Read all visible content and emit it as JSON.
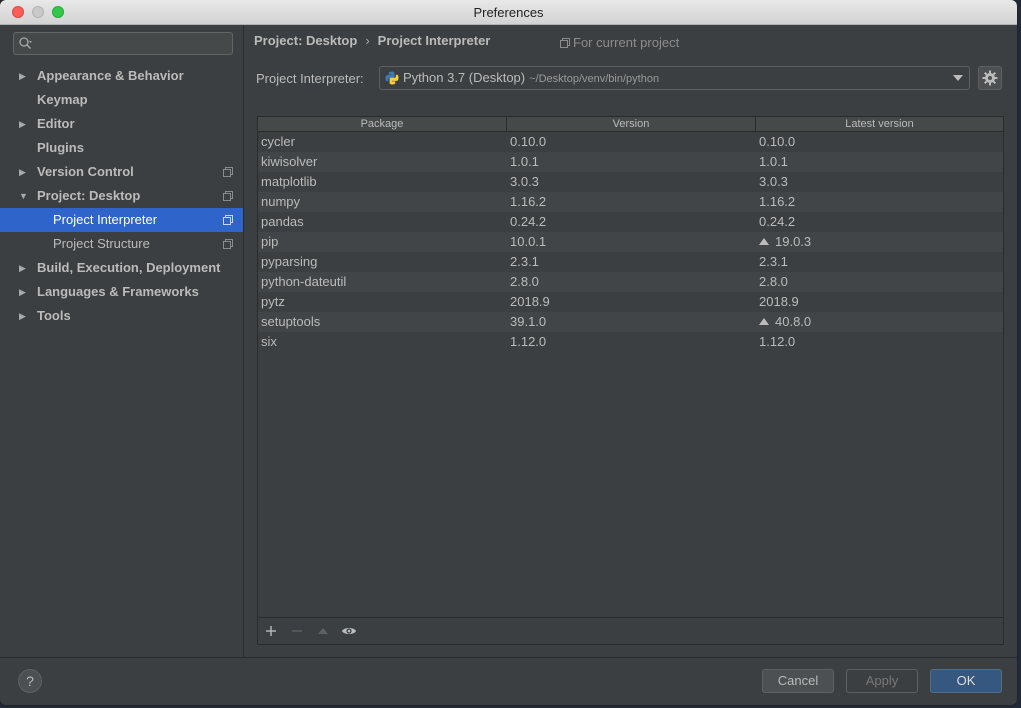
{
  "window": {
    "title": "Preferences"
  },
  "sidebar": {
    "search_placeholder": "",
    "items": [
      {
        "label": "Appearance & Behavior",
        "arrow": "▶"
      },
      {
        "label": "Keymap"
      },
      {
        "label": "Editor",
        "arrow": "▶"
      },
      {
        "label": "Plugins"
      },
      {
        "label": "Version Control",
        "arrow": "▶"
      },
      {
        "label": "Project: Desktop",
        "arrow": "▼"
      },
      {
        "label": "Project Interpreter"
      },
      {
        "label": "Project Structure"
      },
      {
        "label": "Build, Execution, Deployment",
        "arrow": "▶"
      },
      {
        "label": "Languages & Frameworks",
        "arrow": "▶"
      },
      {
        "label": "Tools",
        "arrow": "▶"
      }
    ]
  },
  "breadcrumb": {
    "parent": "Project: Desktop",
    "sep": "›",
    "current": "Project Interpreter"
  },
  "scope_note": "For current project",
  "interpreter": {
    "label": "Project Interpreter:",
    "name": "Python 3.7 (Desktop)",
    "path": "~/Desktop/venv/bin/python"
  },
  "packages": {
    "columns": [
      "Package",
      "Version",
      "Latest version"
    ],
    "rows": [
      {
        "package": "cycler",
        "version": "0.10.0",
        "latest": "0.10.0",
        "upgrade": false
      },
      {
        "package": "kiwisolver",
        "version": "1.0.1",
        "latest": "1.0.1",
        "upgrade": false
      },
      {
        "package": "matplotlib",
        "version": "3.0.3",
        "latest": "3.0.3",
        "upgrade": false
      },
      {
        "package": "numpy",
        "version": "1.16.2",
        "latest": "1.16.2",
        "upgrade": false
      },
      {
        "package": "pandas",
        "version": "0.24.2",
        "latest": "0.24.2",
        "upgrade": false
      },
      {
        "package": "pip",
        "version": "10.0.1",
        "latest": "19.0.3",
        "upgrade": true
      },
      {
        "package": "pyparsing",
        "version": "2.3.1",
        "latest": "2.3.1",
        "upgrade": false
      },
      {
        "package": "python-dateutil",
        "version": "2.8.0",
        "latest": "2.8.0",
        "upgrade": false
      },
      {
        "package": "pytz",
        "version": "2018.9",
        "latest": "2018.9",
        "upgrade": false
      },
      {
        "package": "setuptools",
        "version": "39.1.0",
        "latest": "40.8.0",
        "upgrade": true
      },
      {
        "package": "six",
        "version": "1.12.0",
        "latest": "1.12.0",
        "upgrade": false
      }
    ]
  },
  "footer": {
    "help": "?",
    "cancel": "Cancel",
    "apply": "Apply",
    "ok": "OK"
  },
  "colors": {
    "selection": "#2f65ca",
    "ok_button": "#365880",
    "panel": "#3c3f41"
  }
}
